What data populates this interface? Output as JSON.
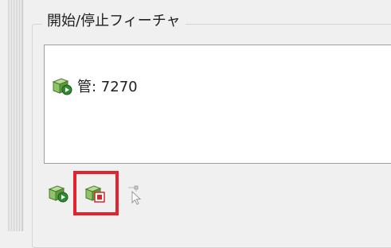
{
  "panel": {
    "title": "開始/停止フィーチャ"
  },
  "list": {
    "items": [
      {
        "label": "管: 7270",
        "icon": "feature-start-icon"
      }
    ]
  },
  "toolbar": {
    "buttons": [
      {
        "name": "start-feature-button",
        "icon": "feature-start-icon",
        "enabled": true
      },
      {
        "name": "stop-feature-button",
        "icon": "feature-stop-icon",
        "enabled": true,
        "highlighted": true
      },
      {
        "name": "select-feature-button",
        "icon": "pointer-select-icon",
        "enabled": false
      }
    ]
  },
  "colors": {
    "cube": "#7fb65a",
    "start_badge": "#2e8b2e",
    "stop_badge": "#d22a2a",
    "highlight": "#e4222d"
  }
}
